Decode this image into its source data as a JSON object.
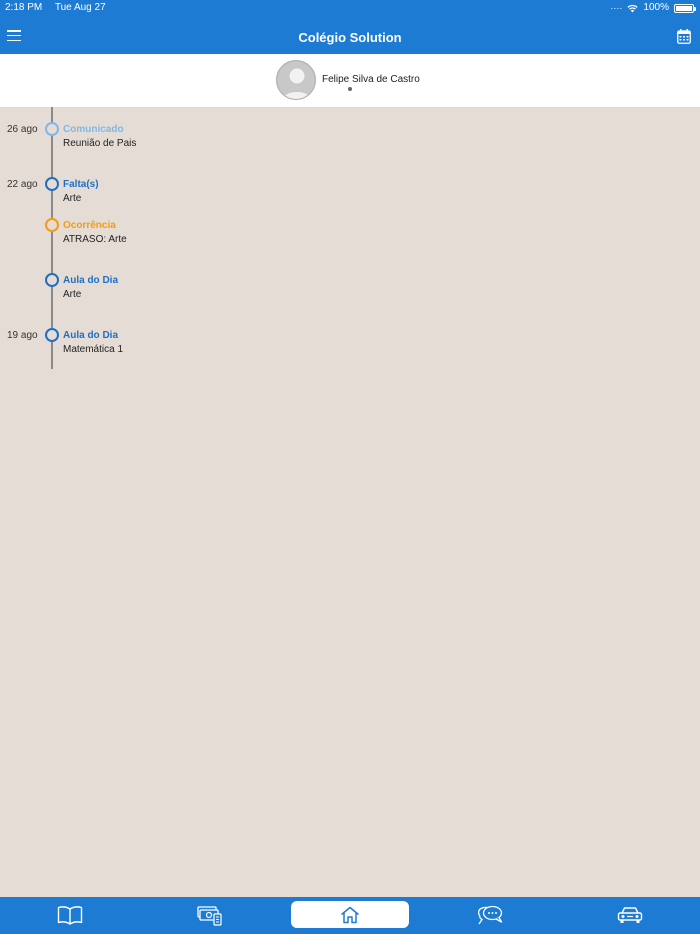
{
  "status_bar": {
    "time": "2:18 PM",
    "date": "Tue Aug 27",
    "battery": "100%",
    "wifi_icon": "wifi-icon",
    "battery_icon": "battery-icon"
  },
  "nav": {
    "title": "Colégio Solution",
    "menu_icon": "hamburger-menu-icon",
    "calendar_icon": "calendar-icon"
  },
  "student": {
    "name": "Felipe Silva de Castro",
    "avatar_icon": "user-avatar-icon"
  },
  "colors": {
    "primary": "#1e7bd4",
    "event_blue": "#1e6fc4",
    "event_light_blue": "#7fb7e8",
    "event_orange": "#f39c12",
    "background": "#e5ddd5"
  },
  "timeline": [
    {
      "date": "26 ago",
      "title": "Comunicado",
      "description": "Reunião de Pais",
      "color": "#7fb7e8"
    },
    {
      "date": "22 ago",
      "title": "Falta(s)",
      "description": "Arte",
      "color": "#1e6fc4"
    },
    {
      "date": "",
      "title": "Ocorrência",
      "description": "ATRASO: Arte",
      "color": "#f39c12"
    },
    {
      "date": "",
      "title": "Aula do Dia",
      "description": "Arte",
      "color": "#1e6fc4"
    },
    {
      "date": "19 ago",
      "title": "Aula do Dia",
      "description": "Matemática 1",
      "color": "#1e6fc4"
    }
  ],
  "tabs": [
    {
      "icon": "book-icon",
      "active": false
    },
    {
      "icon": "finance-icon",
      "active": false
    },
    {
      "icon": "home-icon",
      "active": true
    },
    {
      "icon": "chat-icon",
      "active": false
    },
    {
      "icon": "car-icon",
      "active": false
    }
  ]
}
